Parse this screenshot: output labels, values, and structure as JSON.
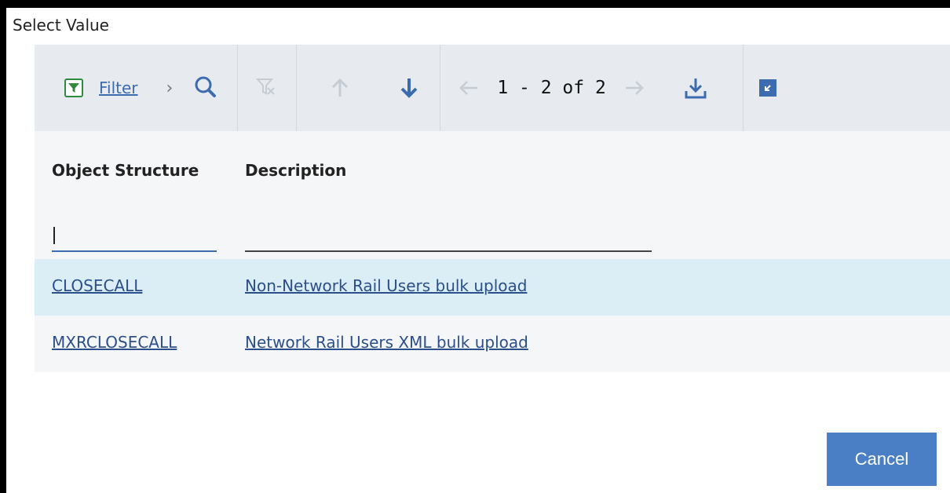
{
  "dialog": {
    "title": "Select Value"
  },
  "toolbar": {
    "filter_label": "Filter",
    "pager_text": "1 - 2 of 2",
    "colors": {
      "filter_icon": "#2e8b3e",
      "active_icon": "#3c6bb0",
      "disabled_icon": "#c6ccd3"
    }
  },
  "table": {
    "columns": [
      "Object Structure",
      "Description"
    ],
    "filters": {
      "object_structure": "",
      "description": ""
    },
    "rows": [
      {
        "object_structure": "CLOSECALL",
        "description": "Non-Network Rail Users bulk upload",
        "selected": true
      },
      {
        "object_structure": "MXRCLOSECALL",
        "description": "Network Rail Users XML bulk upload",
        "selected": false
      }
    ]
  },
  "footer": {
    "cancel_label": "Cancel"
  }
}
